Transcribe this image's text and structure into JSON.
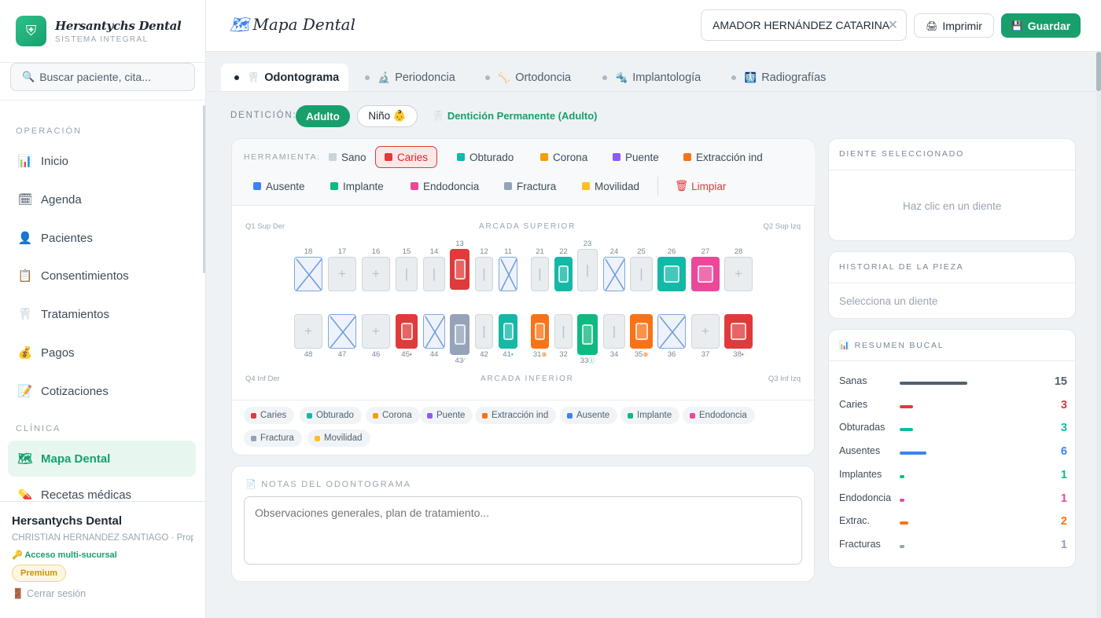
{
  "brand": {
    "name": "Hersantychs Dental",
    "subtitle": "SISTEMA INTEGRAL",
    "logo": "tooth-icon"
  },
  "search": {
    "placeholder": "Buscar paciente, cita..."
  },
  "sidebar": {
    "section_ops": "OPERACIÓN",
    "section_clinic": "CLÍNICA",
    "items": [
      {
        "label": "Inicio",
        "icon": "📊"
      },
      {
        "label": "Agenda",
        "icon": "🗓"
      },
      {
        "label": "Pacientes",
        "icon": "👤"
      },
      {
        "label": "Consentimientos",
        "icon": "📋"
      },
      {
        "label": "Tratamientos",
        "icon": "🦷"
      },
      {
        "label": "Pagos",
        "icon": "💰"
      },
      {
        "label": "Cotizaciones",
        "icon": "📝"
      },
      {
        "label": "Mapa Dental",
        "icon": "🗺"
      },
      {
        "label": "Recetas médicas",
        "icon": "💊"
      }
    ],
    "footer": {
      "clinic": "Hersantychs Dental",
      "user": "CHRISTIAN HERNÁNDEZ SANTIAGO · Propi...",
      "access": "Acceso multi-sucursal",
      "plan": "Premium",
      "logout": "Cerrar sesión"
    }
  },
  "header": {
    "title": "Mapa Dental",
    "patient": "AMADOR HERNÁNDEZ CATARINA",
    "print": "Imprimir",
    "save": "Guardar"
  },
  "tabs": [
    "Odontograma",
    "Periodoncia",
    "Ortodoncia",
    "Implantología",
    "Radiografías"
  ],
  "dentition": {
    "label": "DENTICIÓN:",
    "adult": "Adulto",
    "child": "Niño 👶",
    "info": "Dentición Permanente (Adulto)"
  },
  "tools": {
    "label": "HERRAMIENTA:",
    "items": [
      {
        "label": "Sano",
        "color": "#cbd2d9"
      },
      {
        "label": "Caries",
        "color": "#e03a3a"
      },
      {
        "label": "Obturado",
        "color": "#14b8a6"
      },
      {
        "label": "Corona",
        "color": "#f59e0b"
      },
      {
        "label": "Puente",
        "color": "#8b5cf6"
      },
      {
        "label": "Extracción ind",
        "color": "#f97316"
      },
      {
        "label": "Ausente",
        "color": "#3b82f6"
      },
      {
        "label": "Implante",
        "color": "#10b981"
      },
      {
        "label": "Endodoncia",
        "color": "#ec4899"
      },
      {
        "label": "Fractura",
        "color": "#94a3b8"
      },
      {
        "label": "Movilidad",
        "color": "#fbbf24"
      }
    ],
    "clear": "Limpiar"
  },
  "odontogram": {
    "upper_label": "ARCADA SUPERIOR",
    "lower_label": "ARCADA INFERIOR",
    "q1": "Q1 Sup Der",
    "q2": "Q2 Sup Izq",
    "q3": "Q3 Inf Izq",
    "q4": "Q4 Inf Der",
    "upper": [
      {
        "n": "18",
        "state": "ausente"
      },
      {
        "n": "17",
        "state": "sano"
      },
      {
        "n": "16",
        "state": "sano"
      },
      {
        "n": "15",
        "state": "sano"
      },
      {
        "n": "14",
        "state": "sano"
      },
      {
        "n": "13",
        "state": "caries"
      },
      {
        "n": "12",
        "state": "sano"
      },
      {
        "n": "11",
        "state": "ausente"
      },
      {
        "n": "21",
        "state": "sano"
      },
      {
        "n": "22",
        "state": "obturado"
      },
      {
        "n": "23",
        "state": "sano"
      },
      {
        "n": "24",
        "state": "ausente"
      },
      {
        "n": "25",
        "state": "sano"
      },
      {
        "n": "26",
        "state": "obturado"
      },
      {
        "n": "27",
        "state": "endodoncia"
      },
      {
        "n": "28",
        "state": "sano"
      }
    ],
    "lower": [
      {
        "n": "48",
        "state": "sano"
      },
      {
        "n": "47",
        "state": "ausente"
      },
      {
        "n": "46",
        "state": "sano"
      },
      {
        "n": "45",
        "state": "caries",
        "mark": "•"
      },
      {
        "n": "44",
        "state": "ausente"
      },
      {
        "n": "43",
        "state": "fractura",
        "mark": "⁄"
      },
      {
        "n": "42",
        "state": "sano"
      },
      {
        "n": "41",
        "state": "obturado",
        "mark": "•"
      },
      {
        "n": "31",
        "state": "extraccion",
        "mark": "⊗"
      },
      {
        "n": "32",
        "state": "sano"
      },
      {
        "n": "33",
        "state": "implante",
        "mark": "Ⓘ"
      },
      {
        "n": "34",
        "state": "sano"
      },
      {
        "n": "35",
        "state": "extraccion",
        "mark": "⊗"
      },
      {
        "n": "36",
        "state": "ausente"
      },
      {
        "n": "37",
        "state": "sano"
      },
      {
        "n": "38",
        "state": "caries",
        "mark": "•"
      }
    ]
  },
  "legend": [
    {
      "label": "Caries",
      "color": "#e03a3a"
    },
    {
      "label": "Obturado",
      "color": "#14b8a6"
    },
    {
      "label": "Corona",
      "color": "#f59e0b"
    },
    {
      "label": "Puente",
      "color": "#8b5cf6"
    },
    {
      "label": "Extracción ind",
      "color": "#f97316"
    },
    {
      "label": "Ausente",
      "color": "#3b82f6"
    },
    {
      "label": "Implante",
      "color": "#10b981"
    },
    {
      "label": "Endodoncia",
      "color": "#ec4899"
    },
    {
      "label": "Fractura",
      "color": "#94a3b8"
    },
    {
      "label": "Movilidad",
      "color": "#fbbf24"
    }
  ],
  "notes": {
    "title": "NOTAS DEL ODONTOGRAMA",
    "placeholder": "Observaciones generales, plan de tratamiento..."
  },
  "selected": {
    "title": "DIENTE SELECCIONADO",
    "empty": "Haz clic en un diente"
  },
  "history": {
    "title": "HISTORIAL DE LA PIEZA",
    "empty": "Selecciona un diente"
  },
  "summary": {
    "title": "RESUMEN BUCAL",
    "rows": [
      {
        "label": "Sanas",
        "value": 15,
        "color": "#52606d"
      },
      {
        "label": "Caries",
        "value": 3,
        "color": "#e03a3a"
      },
      {
        "label": "Obturadas",
        "value": 3,
        "color": "#14b8a6"
      },
      {
        "label": "Ausentes",
        "value": 6,
        "color": "#3b82f6"
      },
      {
        "label": "Implantes",
        "value": 1,
        "color": "#10b981"
      },
      {
        "label": "Endodoncia",
        "value": 1,
        "color": "#ec4899"
      },
      {
        "label": "Extrac.",
        "value": 2,
        "color": "#f97316"
      },
      {
        "label": "Fracturas",
        "value": 1,
        "color": "#94a3b8"
      }
    ]
  }
}
